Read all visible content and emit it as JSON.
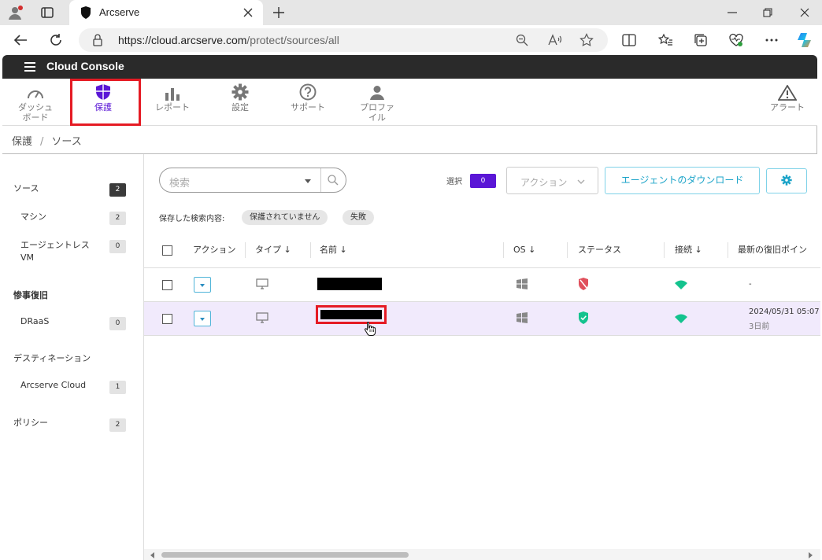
{
  "browser": {
    "tab_title": "Arcserve",
    "url_host": "https://cloud.arcserve.com",
    "url_path": "/protect/sources/all"
  },
  "app": {
    "title": "Cloud Console"
  },
  "nav": {
    "items": [
      {
        "label": "ダッシュボード",
        "icon": "dashboard-icon"
      },
      {
        "label": "保護",
        "icon": "shield-icon",
        "active": true
      },
      {
        "label": "レポート",
        "icon": "bar-chart-icon"
      },
      {
        "label": "設定",
        "icon": "gear-icon"
      },
      {
        "label": "サポート",
        "icon": "help-icon"
      },
      {
        "label": "プロファイル",
        "icon": "person-icon"
      },
      {
        "label": "アラート",
        "icon": "warning-icon"
      }
    ],
    "dashboard_l1": "ダッシュ",
    "dashboard_l2": "ボード",
    "profile_l1": "プロファ",
    "profile_l2": "イル"
  },
  "breadcrumb": {
    "root": "保護",
    "sep": "/",
    "current": "ソース"
  },
  "sidebar": {
    "sources": {
      "label": "ソース",
      "count": "2"
    },
    "machine": {
      "label": "マシン",
      "count": "2"
    },
    "agentless_l1": "エージェントレス",
    "agentless_l2": "VM",
    "agentless_count": "0",
    "dr": {
      "label": "惨事復旧"
    },
    "draas": {
      "label": "DRaaS",
      "count": "0"
    },
    "destination": {
      "label": "デスティネーション"
    },
    "arccloud": {
      "label": "Arcserve Cloud",
      "count": "1"
    },
    "policy": {
      "label": "ポリシー",
      "count": "2"
    }
  },
  "toolbar": {
    "search_placeholder": "検索",
    "selected_label": "選択",
    "selected_count": "0",
    "action_label": "アクション",
    "download_label": "エージェントのダウンロード",
    "saved_search_label": "保存した検索内容:",
    "chip_unprotected": "保護されていません",
    "chip_failed": "失敗"
  },
  "table": {
    "headers": {
      "action": "アクション",
      "type": "タイプ",
      "name": "名前",
      "os": "OS",
      "status": "ステータス",
      "connection": "接続",
      "last_recovery": "最新の復旧ポイン"
    },
    "rows": [
      {
        "last_recovery": "-",
        "last_recovery_sub": "",
        "status": "unprotected"
      },
      {
        "last_recovery": "2024/05/31 05:07",
        "last_recovery_sub": "3日前",
        "status": "protected"
      }
    ]
  },
  "colors": {
    "accent": "#5a16d6",
    "highlight": "#e51b24",
    "link": "#1aa3c8",
    "ok_green": "#14c38e",
    "danger_red": "#e0505c"
  }
}
